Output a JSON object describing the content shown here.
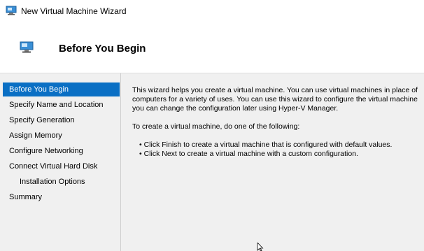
{
  "window": {
    "title": "New Virtual Machine Wizard"
  },
  "header": {
    "title": "Before You Begin"
  },
  "nav": {
    "items": [
      {
        "label": "Before You Begin",
        "selected": true,
        "indent": false
      },
      {
        "label": "Specify Name and Location",
        "selected": false,
        "indent": false
      },
      {
        "label": "Specify Generation",
        "selected": false,
        "indent": false
      },
      {
        "label": "Assign Memory",
        "selected": false,
        "indent": false
      },
      {
        "label": "Configure Networking",
        "selected": false,
        "indent": false
      },
      {
        "label": "Connect Virtual Hard Disk",
        "selected": false,
        "indent": false
      },
      {
        "label": "Installation Options",
        "selected": false,
        "indent": true
      },
      {
        "label": "Summary",
        "selected": false,
        "indent": false
      }
    ]
  },
  "content": {
    "intro_lines": [
      "This wizard helps you create a virtual machine. You can use virtual machines in place of",
      "computers for a variety of uses. You can use this wizard to configure the virtual machine",
      "you can change the configuration later using Hyper-V Manager."
    ],
    "instruction": "To create a virtual machine, do one of the following:",
    "bullets": [
      "• Click Finish to create a virtual machine that is configured with default values.",
      "• Click Next to create a virtual machine with a custom configuration."
    ]
  },
  "colors": {
    "selection": "#0a6fc4",
    "panel_background": "#f0f0f0",
    "header_background": "#ffffff"
  },
  "icons": {
    "title": "virtual-machine-icon",
    "header": "virtual-machine-icon",
    "pointer": "mouse-cursor-icon"
  }
}
